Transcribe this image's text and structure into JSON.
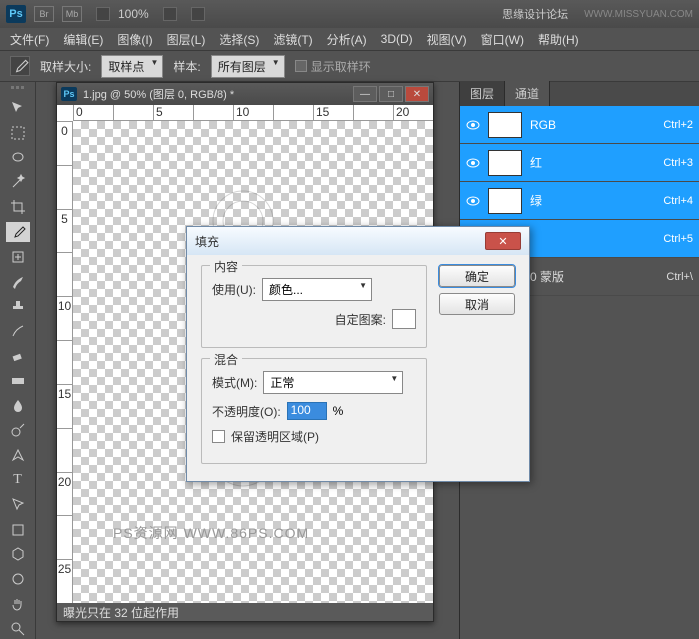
{
  "watermark": {
    "site": "思缘设计论坛",
    "url": "WWW.MISSYUAN.COM"
  },
  "titlebar": {
    "zoom": "100%"
  },
  "menu": {
    "file": "文件(F)",
    "edit": "编辑(E)",
    "image": "图像(I)",
    "layer": "图层(L)",
    "select": "选择(S)",
    "filter": "滤镜(T)",
    "analysis": "分析(A)",
    "threeD": "3D(D)",
    "view": "视图(V)",
    "window": "窗口(W)",
    "help": "帮助(H)"
  },
  "options": {
    "sample_size_label": "取样大小:",
    "sample_size_value": "取样点",
    "sample_label": "样本:",
    "sample_value": "所有图层",
    "show_ring_label": "显示取样环"
  },
  "ruler_h": [
    "0",
    "",
    "5",
    "",
    "10",
    "",
    "15",
    "",
    "20"
  ],
  "ruler_v": [
    "0",
    "",
    "5",
    "",
    "10",
    "",
    "15",
    "",
    "20",
    "",
    "25"
  ],
  "doc": {
    "title": "1.jpg @ 50% (图层 0, RGB/8) *",
    "status": "曝光只在 32 位起作用",
    "canvas_watermark": "PS资源网  WWW.86PS.COM"
  },
  "panel": {
    "tab_layers": "图层",
    "tab_channels": "通道",
    "channels": [
      {
        "name": "RGB",
        "shortcut": "Ctrl+2",
        "selected": true
      },
      {
        "name": "红",
        "shortcut": "Ctrl+3",
        "selected": true
      },
      {
        "name": "绿",
        "shortcut": "Ctrl+4",
        "selected": true
      },
      {
        "name": "",
        "shortcut": "Ctrl+5",
        "selected": true
      },
      {
        "name": "0 蒙版",
        "shortcut": "Ctrl+\\",
        "selected": false
      }
    ]
  },
  "dialog": {
    "title": "填充",
    "content_legend": "内容",
    "use_label": "使用(U):",
    "use_value": "颜色...",
    "custom_label": "自定图案:",
    "blend_legend": "混合",
    "mode_label": "模式(M):",
    "mode_value": "正常",
    "opacity_label": "不透明度(O):",
    "opacity_value": "100",
    "percent": "%",
    "preserve_label": "保留透明区域(P)",
    "ok": "确定",
    "cancel": "取消"
  }
}
